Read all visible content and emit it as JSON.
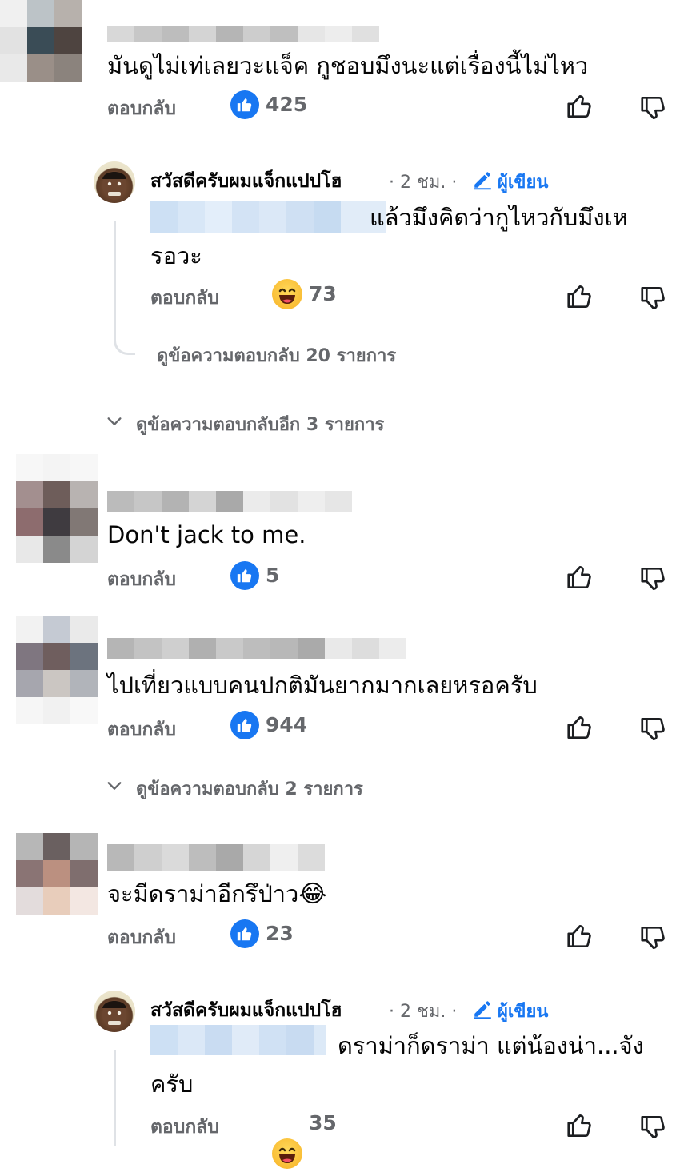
{
  "ui": {
    "reply_label": "ตอบกลับ",
    "author_time": "2 ชม.",
    "author_badge": "ผู้เขียน",
    "author_name": "สวัสดีครับผมแจ็กแปปโฮ"
  },
  "comments": [
    {
      "text": "มันดูไม่เท่เลยวะแจ็ค กูชอบมึงนะแต่เรื่องนี้ไม่ไหว",
      "reaction_count": "425",
      "author_reply": {
        "text_line1": "แล้วมึงคิดว่ากูไหวกับมึงเห",
        "text_line2": "รอวะ",
        "reaction_count": "73",
        "view_replies": "ดูข้อความตอบกลับ 20 รายการ"
      },
      "more_replies": "ดูข้อความตอบกลับอีก 3 รายการ"
    },
    {
      "text": "Don't jack to me.",
      "reaction_count": "5"
    },
    {
      "text": "ไปเที่ยวแบบคนปกติมันยากมากเลยหรอครับ",
      "reaction_count": "944",
      "more_replies": "ดูข้อความตอบกลับ 2 รายการ"
    },
    {
      "text": "จะมีดราม่าอีกรึป่าว",
      "emoji": "😂",
      "reaction_count": "23",
      "author_reply": {
        "text_line1": "ดราม่าก็ดราม่า แต่น้องน่า...จัง",
        "text_line2": "ครับ",
        "reaction_count": "35"
      }
    }
  ],
  "icons": {
    "like": "thumbs-up-icon",
    "dislike": "thumbs-down-icon",
    "like_badge": "like-reaction-icon",
    "haha_badge": "haha-reaction-icon",
    "pencil": "pencil-icon",
    "chevron": "chevron-down-icon"
  },
  "colors": {
    "accent": "#1877f2",
    "secondary_text": "#65676b",
    "haha_yellow": "#f7b125"
  }
}
